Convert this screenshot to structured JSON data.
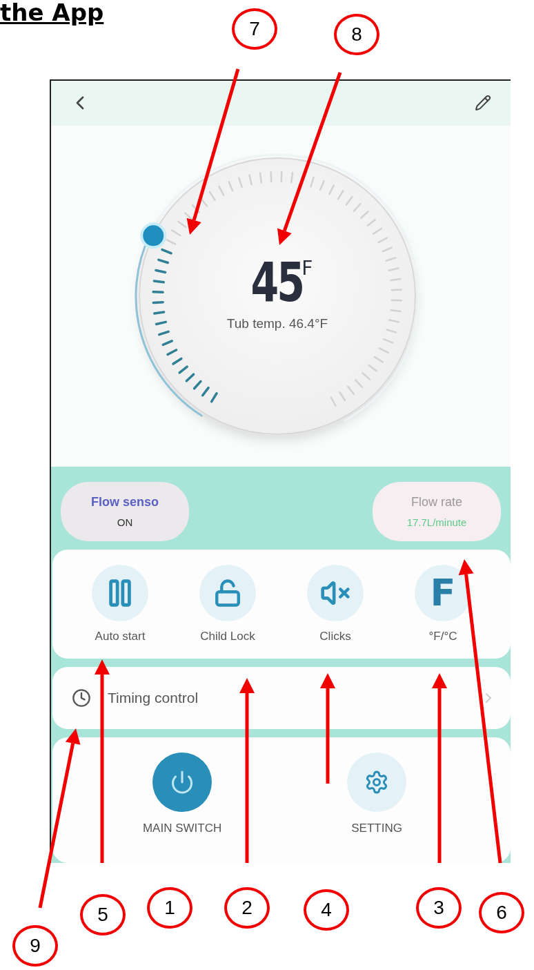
{
  "heading": "the App",
  "app": {
    "dial": {
      "value": "45",
      "unit": "F",
      "tub_temp": "Tub temp. 46.4°F",
      "level": 0.28
    },
    "flow_sensor": {
      "label": "Flow senso",
      "value": "ON"
    },
    "flow_rate": {
      "label": "Flow rate",
      "value": "17.7L/minute"
    },
    "controls": [
      {
        "kind": "pause",
        "label": "Auto start"
      },
      {
        "kind": "lock",
        "label": "Child Lock"
      },
      {
        "kind": "mute",
        "label": "Clicks"
      },
      {
        "kind": "glyph",
        "glyph": "F",
        "label": "°F/°C"
      }
    ],
    "timing": {
      "label": "Timing control"
    },
    "main_switch": {
      "label": "MAIN SWITCH",
      "on": true
    },
    "setting": {
      "label": "SETTING"
    }
  },
  "callouts": [
    "7",
    "8",
    "5",
    "1",
    "2",
    "4",
    "3",
    "6",
    "9"
  ]
}
